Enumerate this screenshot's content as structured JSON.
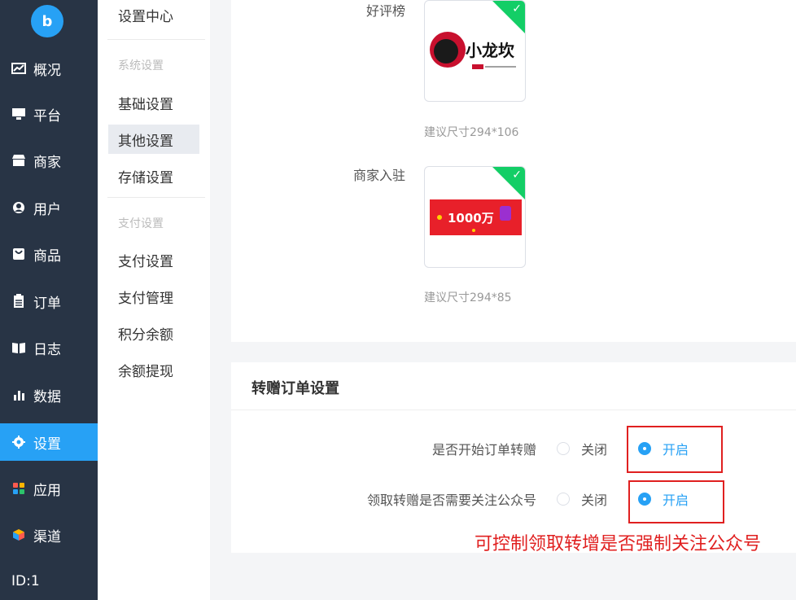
{
  "sidebar": {
    "logo_text": "b",
    "items": [
      {
        "label": "概况",
        "icon": "chart-icon"
      },
      {
        "label": "平台",
        "icon": "monitor-icon"
      },
      {
        "label": "商家",
        "icon": "store-icon"
      },
      {
        "label": "用户",
        "icon": "user-icon"
      },
      {
        "label": "商品",
        "icon": "bag-icon"
      },
      {
        "label": "订单",
        "icon": "clipboard-icon"
      },
      {
        "label": "日志",
        "icon": "book-icon"
      },
      {
        "label": "数据",
        "icon": "bar-chart-icon"
      },
      {
        "label": "设置",
        "icon": "gear-icon"
      },
      {
        "label": "应用",
        "icon": "apps-icon"
      },
      {
        "label": "渠道",
        "icon": "cube-icon"
      }
    ],
    "active_index": 8,
    "id_text": "ID:1"
  },
  "subsidebar": {
    "title": "设置中心",
    "group_system": "系统设置",
    "system_items": [
      "基础设置",
      "其他设置",
      "存储设置"
    ],
    "group_pay": "支付设置",
    "pay_items": [
      "支付设置",
      "支付管理",
      "积分余额",
      "余额提现"
    ],
    "active_item": "其他设置"
  },
  "top_panel": {
    "good_review": {
      "label": "好评榜",
      "hint": "建议尺寸294*106",
      "image_text": "小龙坎"
    },
    "merchant_join": {
      "label": "商家入驻",
      "hint": "建议尺寸294*85",
      "image_text": "1000万"
    }
  },
  "gift_order": {
    "title": "转赠订单设置",
    "rows": [
      {
        "label": "是否开始订单转赠",
        "off": "关闭",
        "on": "开启",
        "selected": "on"
      },
      {
        "label": "领取转赠是否需要关注公众号",
        "off": "关闭",
        "on": "开启",
        "selected": "on"
      }
    ]
  },
  "annotation": "可控制领取转增是否强制关注公众号",
  "colors": {
    "sidebar_bg": "#283445",
    "accent": "#27a1f5",
    "annotation": "#e02020",
    "check": "#13ce66"
  }
}
